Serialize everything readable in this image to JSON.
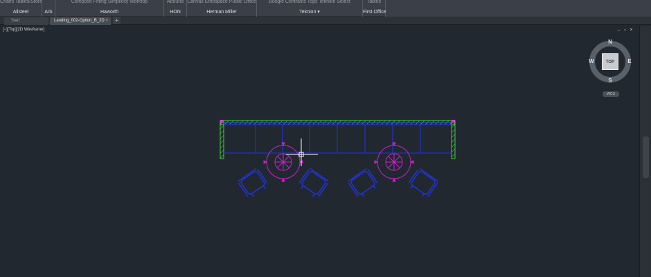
{
  "ribbon": {
    "groups": [
      {
        "top": "Chairs  Tables/Storage  Tables",
        "label": "Allsteel"
      },
      {
        "top": "",
        "label": "AIS"
      },
      {
        "top": "Compose    Fitting    Simplicity  Worktop",
        "label": "Haworth"
      },
      {
        "top": "Abound",
        "label": "HON"
      },
      {
        "top": "Canvas   Ethospace   Public Office",
        "label": "Herman Miller"
      },
      {
        "top": "Boogie   Contrasts   Tops   Teknion Select",
        "label": "Teknion ▾"
      },
      {
        "top": "Tables",
        "label": "First Office"
      }
    ]
  },
  "tabs": {
    "start": "Start",
    "drawing": "Landing_002-Option_B_2D",
    "close": "×",
    "add": "+"
  },
  "viewport": {
    "label": "[−][Top][2D Wireframe]",
    "controls": [
      "–",
      "▫",
      "×"
    ]
  },
  "viewcube": {
    "face": "TOP",
    "north": "N",
    "south": "S",
    "east": "E",
    "west": "W",
    "wcs": "WCS"
  },
  "colors": {
    "background": "#212830",
    "wall": "#3dcf3d",
    "panel": "#2233dd",
    "table": "#cc22cc",
    "cursor": "#ffffff"
  }
}
